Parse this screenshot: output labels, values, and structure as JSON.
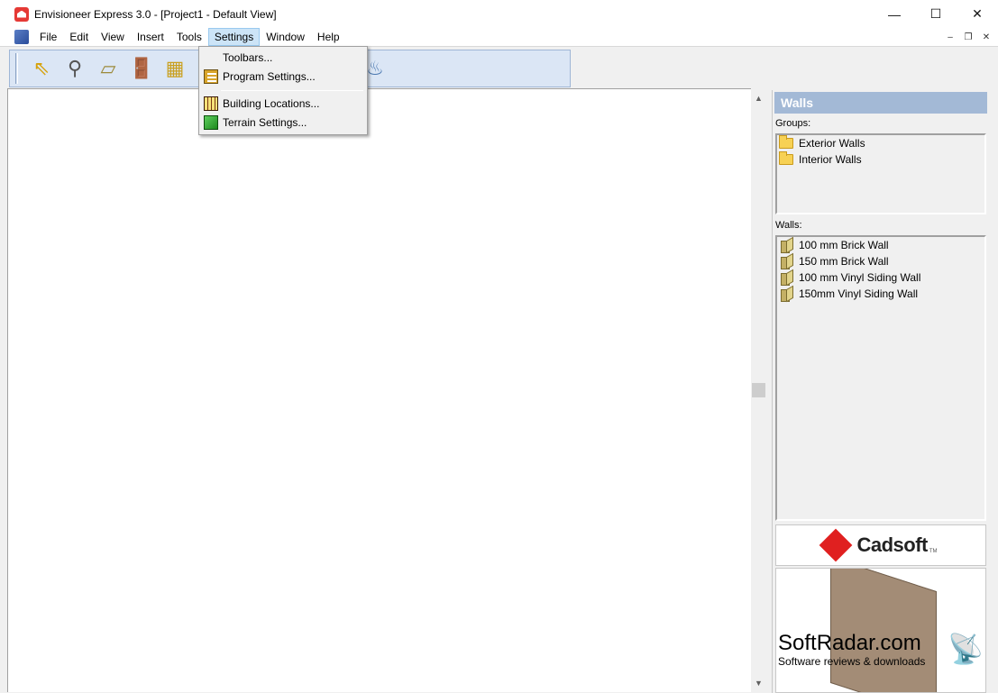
{
  "window": {
    "title": "Envisioneer Express 3.0 - [Project1 - Default View]",
    "controls": {
      "minimize": "—",
      "maximize": "☐",
      "close": "✕"
    }
  },
  "menubar": {
    "items": [
      "File",
      "Edit",
      "View",
      "Insert",
      "Tools",
      "Settings",
      "Window",
      "Help"
    ],
    "active": "Settings",
    "mdi_controls": {
      "minimize": "–",
      "restore": "❐",
      "close": "✕"
    }
  },
  "toolbar": {
    "buttons": [
      {
        "icon": "select-arrow-icon",
        "glyph": "⇖"
      },
      {
        "icon": "dimension-icon",
        "glyph": "⚲"
      },
      {
        "icon": "wall-icon",
        "glyph": "▱"
      },
      {
        "icon": "door-icon",
        "glyph": "🚪"
      },
      {
        "icon": "window-icon",
        "glyph": "▦"
      },
      {
        "icon": "cabinet-icon",
        "glyph": "▮"
      },
      {
        "icon": "stove-icon",
        "glyph": "▤"
      },
      {
        "icon": "tv-icon",
        "glyph": "▭"
      },
      {
        "icon": "furniture-icon",
        "glyph": "♜"
      },
      {
        "icon": "lamp-icon",
        "glyph": "♆"
      },
      {
        "icon": "sink-icon",
        "glyph": "♨"
      }
    ]
  },
  "settings_menu": {
    "items": [
      {
        "label": "Toolbars...",
        "icon": "none"
      },
      {
        "label": "Program Settings...",
        "icon": "program-settings-icon"
      },
      {
        "label": "Building Locations...",
        "icon": "building-icon"
      },
      {
        "label": "Terrain Settings...",
        "icon": "terrain-icon"
      }
    ]
  },
  "panel": {
    "header": "Walls",
    "groups_label": "Groups:",
    "groups": [
      "Exterior Walls",
      "Interior Walls"
    ],
    "walls_label": "Walls:",
    "walls": [
      "100 mm Brick Wall",
      "150 mm Brick Wall",
      "100 mm Vinyl Siding Wall",
      "150mm Vinyl Siding Wall"
    ],
    "logo": {
      "text": "Cadsoft",
      "tm": "TM"
    }
  },
  "watermark": {
    "title": "SoftRadar.com",
    "subtitle": "Software reviews & downloads"
  },
  "colors": {
    "panel_header": "#a3b9d6",
    "toolbar_bg": "#dbe6f5",
    "menu_active": "#cce4f7",
    "logo_red": "#e02020"
  }
}
